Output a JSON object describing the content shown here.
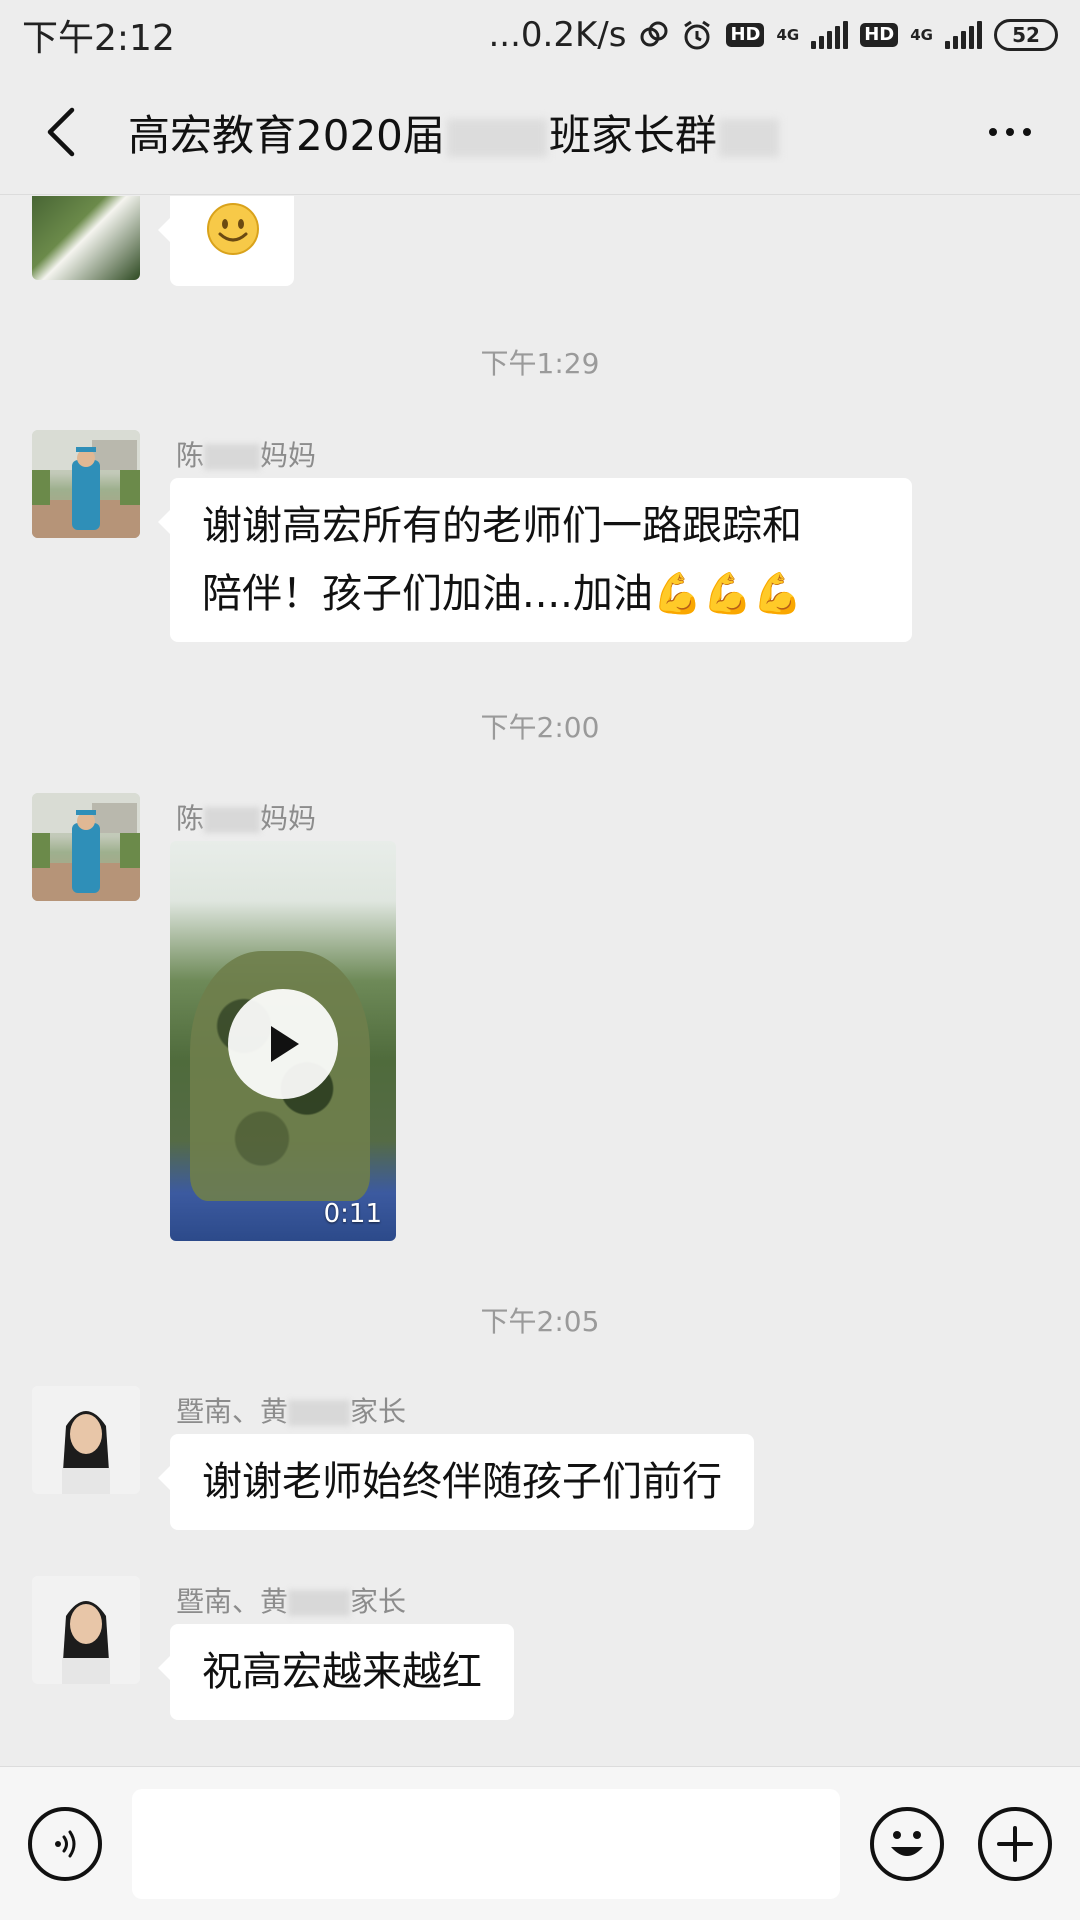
{
  "status_bar": {
    "time": "下午2:12",
    "network_speed": "...0.2K/s",
    "battery": "52",
    "network_type_1": "4G",
    "network_type_2": "4G",
    "hd_1": "HD",
    "hd_2": "HD"
  },
  "header": {
    "title_part1": "高宏教育2020届",
    "title_part2": "班家长群"
  },
  "messages": [
    {
      "type": "emoji",
      "emoji": "🙂"
    },
    {
      "type": "time",
      "text": "下午1:29"
    },
    {
      "type": "text",
      "sender_prefix": "陈",
      "sender_suffix": "妈妈",
      "lines": [
        "谢谢高宏所有的老师们一路跟踪和",
        "陪伴！孩子们加油....加油💪💪💪"
      ]
    },
    {
      "type": "time",
      "text": "下午2:00"
    },
    {
      "type": "video",
      "sender_prefix": "陈",
      "sender_suffix": "妈妈",
      "duration": "0:11"
    },
    {
      "type": "time",
      "text": "下午2:05"
    },
    {
      "type": "text",
      "sender_prefix": "暨南、黄",
      "sender_suffix": "家长",
      "lines": [
        "谢谢老师始终伴随孩子们前行"
      ]
    },
    {
      "type": "text",
      "sender_prefix": "暨南、黄",
      "sender_suffix": "家长",
      "lines": [
        "祝高宏越来越红"
      ]
    }
  ],
  "input": {
    "placeholder": ""
  }
}
